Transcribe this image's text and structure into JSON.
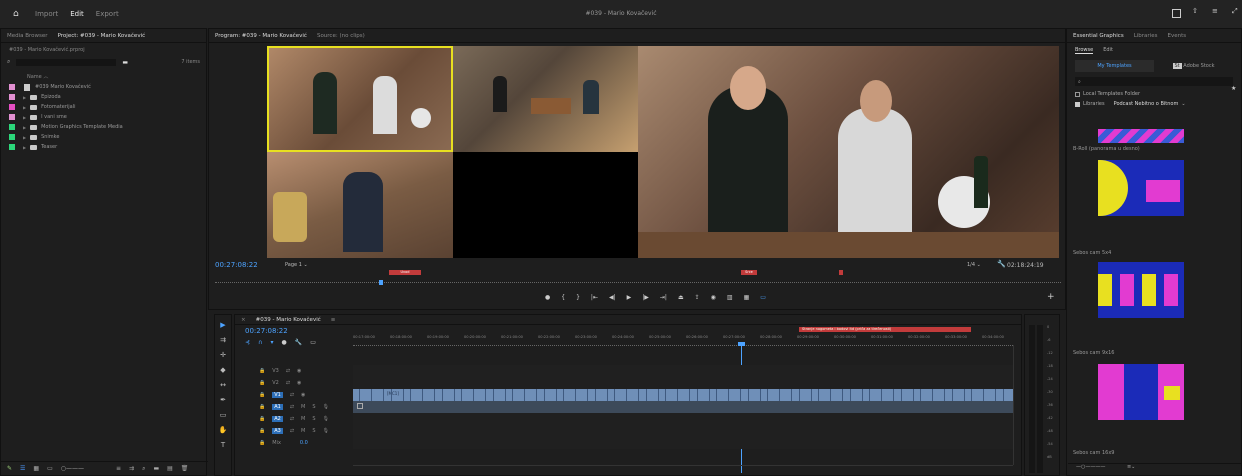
{
  "topbar": {
    "import": "Import",
    "edit": "Edit",
    "export": "Export",
    "title": "#039 - Mario Kovačević"
  },
  "project": {
    "tabs": [
      "Media Browser",
      "Project: #039 - Mario Kovačević"
    ],
    "file": "#039 - Mario Kovačević.prproj",
    "item_count": "7 items",
    "column_name": "Name",
    "items": [
      {
        "label": "#039 Mario Kovačević",
        "color": "#e28fd1",
        "type": "sequence"
      },
      {
        "label": "Epizoda",
        "color": "#e28fd1",
        "type": "folder"
      },
      {
        "label": "Fotomaterijali",
        "color": "#e64fc3",
        "type": "folder"
      },
      {
        "label": "I vani sme",
        "color": "#e28fd1",
        "type": "folder"
      },
      {
        "label": "Motion Graphics Template Media",
        "color": "#2bd77a",
        "type": "folder"
      },
      {
        "label": "Snimke",
        "color": "#2bd77a",
        "type": "folder"
      },
      {
        "label": "Teaser",
        "color": "#2bd77a",
        "type": "folder"
      }
    ]
  },
  "program": {
    "tab": "Program: #039 - Mario Kovačević",
    "source": "Source: (no clips)",
    "timecode": "00:27:08:22",
    "page": "Page 1",
    "fraction": "1/4",
    "duration": "02:18:24:19",
    "markers": [
      "Uvod",
      "Srce"
    ]
  },
  "timeline": {
    "tab": "#039 - Mario Kovačević",
    "timecode": "00:27:08:22",
    "ruler": [
      "00:17:00:00",
      "00:18:00:00",
      "00:19:00:00",
      "00:20:00:00",
      "00:21:00:00",
      "00:22:00:00",
      "00:23:00:00",
      "00:24:00:00",
      "00:25:00:00",
      "00:26:00:00",
      "00:27:00:00",
      "00:28:00:00",
      "00:29:00:00",
      "00:30:00:00",
      "00:31:00:00",
      "00:32:00:00",
      "00:33:00:00",
      "00:34:00:00"
    ],
    "marker_label": "Stranje nogometa i bodovi itd (priča za tirečenosti)",
    "tracks": [
      "V3",
      "V2",
      "V1",
      "A1",
      "A2",
      "A3"
    ],
    "mix": "Mix",
    "mix_value": "0.0",
    "mc_label": "[MC1]"
  },
  "meter": {
    "ticks": [
      "0",
      "-6",
      "-12",
      "-18",
      "-24",
      "-30",
      "-36",
      "-42",
      "-48",
      "-54",
      "dB"
    ]
  },
  "essential": {
    "tabs": [
      "Essential Graphics",
      "Libraries",
      "Events"
    ],
    "subtabs": [
      "Browse",
      "Edit"
    ],
    "my_templates": "My Templates",
    "adobe_stock": "Adobe Stock",
    "local_folder": "Local Templates Folder",
    "libraries": "Libraries",
    "library_name": "Podcast Nebitno o Bitnom",
    "templates": [
      "B-Roll (panorama u desno)",
      "Sebos cam 5x4",
      "Sebos cam 9x16",
      "Sebos cam 16x9"
    ]
  }
}
